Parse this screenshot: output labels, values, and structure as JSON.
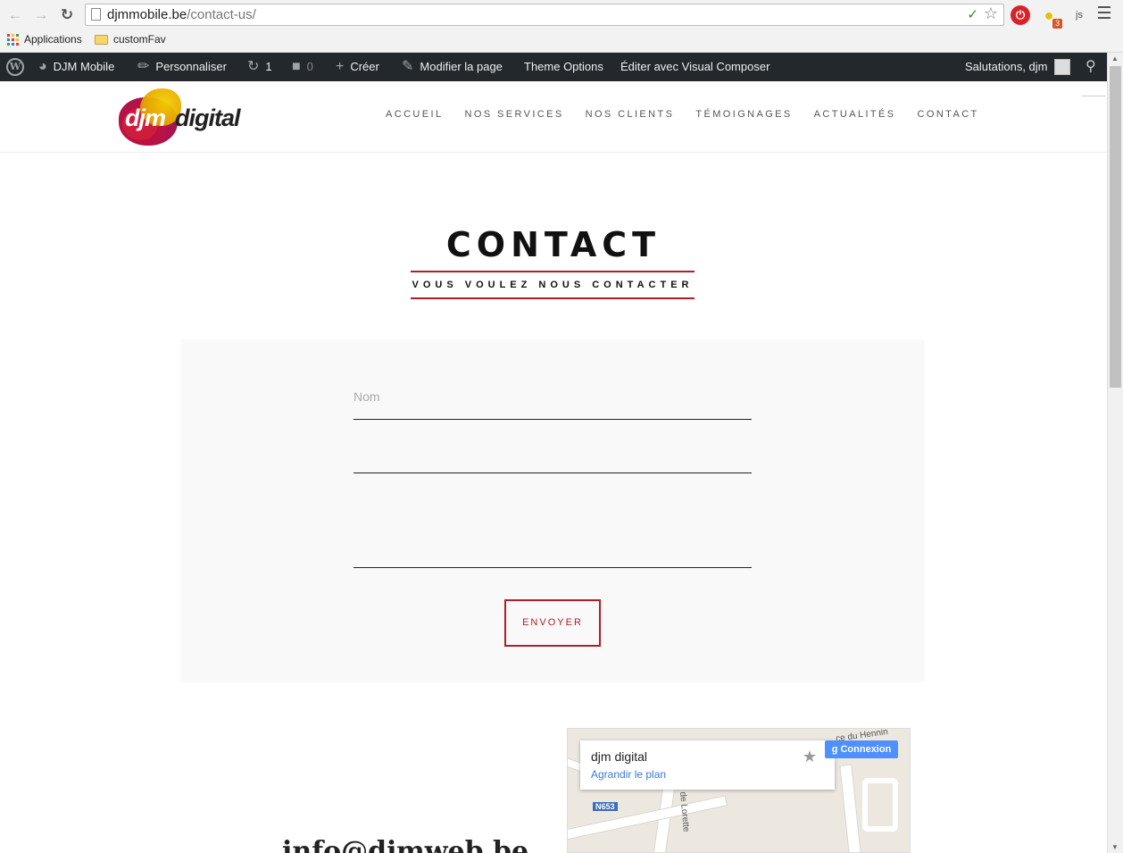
{
  "browser": {
    "url_domain": "djmmobile.be",
    "url_path": "/contact-us/",
    "bookmarks": [
      "Applications",
      "customFav"
    ],
    "extension_badge": "3",
    "extension_js": "js"
  },
  "adminbar": {
    "site_name": "DJM Mobile",
    "customize": "Personnaliser",
    "updates_count": "1",
    "comments_count": "0",
    "new": "Créer",
    "edit_page": "Modifier la page",
    "theme_options": "Theme Options",
    "visual_composer": "Éditer avec Visual Composer",
    "greeting": "Salutations, djm"
  },
  "header": {
    "logo_djm": "djm",
    "logo_digital": "digital",
    "nav": [
      "ACCUEIL",
      "NOS SERVICES",
      "NOS CLIENTS",
      "TÉMOIGNAGES",
      "ACTUALITÉS",
      "CONTACT"
    ]
  },
  "main": {
    "title": "CONTACT",
    "subtitle": "VOUS VOULEZ NOUS CONTACTER",
    "form": {
      "name_placeholder": "Nom",
      "submit_label": "ENVOYER"
    },
    "email_partial": "info@djmweb.be"
  },
  "map": {
    "place_name": "djm digital",
    "enlarge_label": "Agrandir le plan",
    "signin_label": "Connexion",
    "route_label": "N653",
    "street_label_1": "de Lorette",
    "street_label_2": "ce du Hennin"
  },
  "colors": {
    "accent": "#b21e23",
    "adminbar_bg": "#23282d",
    "form_bg": "#f9f9f9"
  }
}
